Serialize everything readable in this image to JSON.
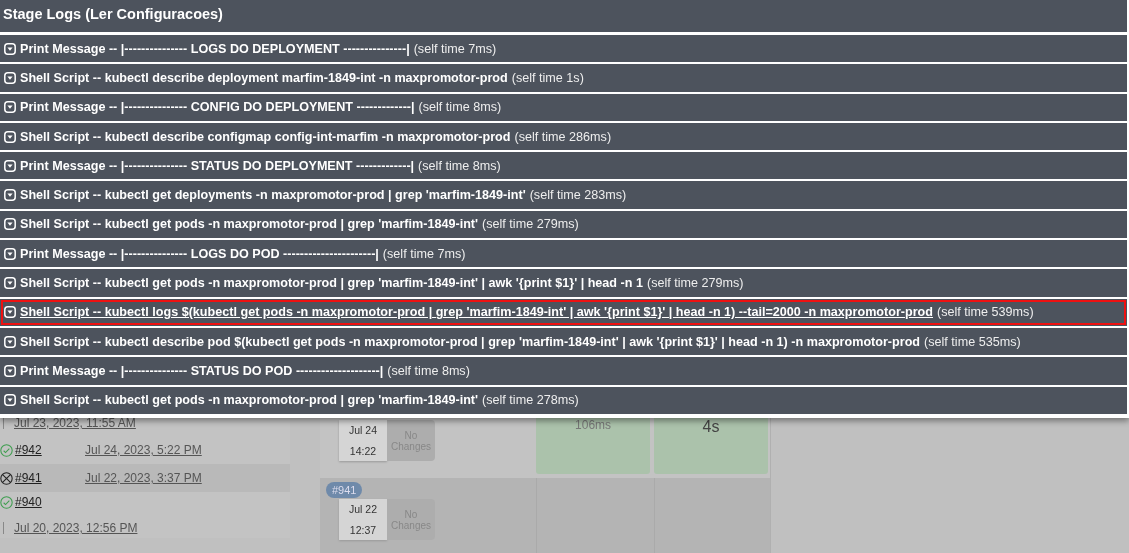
{
  "modal": {
    "title": "Stage Logs (Ler Configuracoes)",
    "steps": [
      {
        "label": "Print Message -- |--------------- LOGS DO DEPLOYMENT ---------------|",
        "time": "(self time 7ms)",
        "selected": false
      },
      {
        "label": "Shell Script -- kubectl describe deployment marfim-1849-int -n maxpromotor-prod",
        "time": "(self time 1s)",
        "selected": false
      },
      {
        "label": "Print Message -- |--------------- CONFIG DO DEPLOYMENT -------------|",
        "time": "(self time 8ms)",
        "selected": false
      },
      {
        "label": "Shell Script -- kubectl describe configmap config-int-marfim -n maxpromotor-prod",
        "time": "(self time 286ms)",
        "selected": false
      },
      {
        "label": "Print Message -- |--------------- STATUS DO DEPLOYMENT -------------|",
        "time": "(self time 8ms)",
        "selected": false
      },
      {
        "label": "Shell Script -- kubectl get deployments -n maxpromotor-prod | grep 'marfim-1849-int'",
        "time": "(self time 283ms)",
        "selected": false
      },
      {
        "label": "Shell Script -- kubectl get pods -n maxpromotor-prod | grep 'marfim-1849-int'",
        "time": "(self time 279ms)",
        "selected": false
      },
      {
        "label": "Print Message -- |--------------- LOGS DO POD ----------------------|",
        "time": "(self time 7ms)",
        "selected": false
      },
      {
        "label": "Shell Script -- kubectl get pods -n maxpromotor-prod | grep 'marfim-1849-int' | awk '{print $1}' | head -n 1",
        "time": "(self time 279ms)",
        "selected": false
      },
      {
        "label": "Shell Script -- kubectl logs $(kubectl get pods -n maxpromotor-prod | grep 'marfim-1849-int' | awk '{print $1}' | head -n 1) --tail=2000 -n maxpromotor-prod",
        "time": "(self time 539ms)",
        "selected": true
      },
      {
        "label": "Shell Script -- kubectl describe pod $(kubectl get pods -n maxpromotor-prod | grep 'marfim-1849-int' | awk '{print $1}' | head -n 1) -n maxpromotor-prod",
        "time": "(self time 535ms)",
        "selected": false
      },
      {
        "label": "Print Message -- |--------------- STATUS DO POD --------------------|",
        "time": "(self time 8ms)",
        "selected": false
      },
      {
        "label": "Shell Script -- kubectl get pods -n maxpromotor-prod | grep 'marfim-1849-int'",
        "time": "(self time 278ms)",
        "selected": false
      }
    ]
  },
  "build_history": {
    "partial_date": "Jul 23, 2023, 11:55 AM",
    "builds": [
      {
        "passed": true,
        "number": "#942",
        "date": "Jul 24, 2023, 5:22 PM"
      },
      {
        "passed": false,
        "number": "#941",
        "date": "Jul 22, 2023, 3:37 PM"
      },
      {
        "passed": true,
        "number": "#940",
        "date": "Jul 20, 2023, 12:56 PM"
      }
    ]
  },
  "stage_view": {
    "runs": [
      {
        "date": "Jul 24",
        "time": "14:22",
        "changes": "No Changes",
        "cells": [
          {
            "text": "106ms",
            "kind": "small",
            "passed": true
          },
          {
            "text": "4s",
            "kind": "large",
            "passed": true
          }
        ]
      },
      {
        "badge": "#941",
        "date": "Jul 22",
        "time": "12:37",
        "changes": "No Changes",
        "cells": [
          {
            "kind": "small",
            "passed": false
          },
          {
            "kind": "large",
            "passed": false
          }
        ]
      }
    ]
  }
}
